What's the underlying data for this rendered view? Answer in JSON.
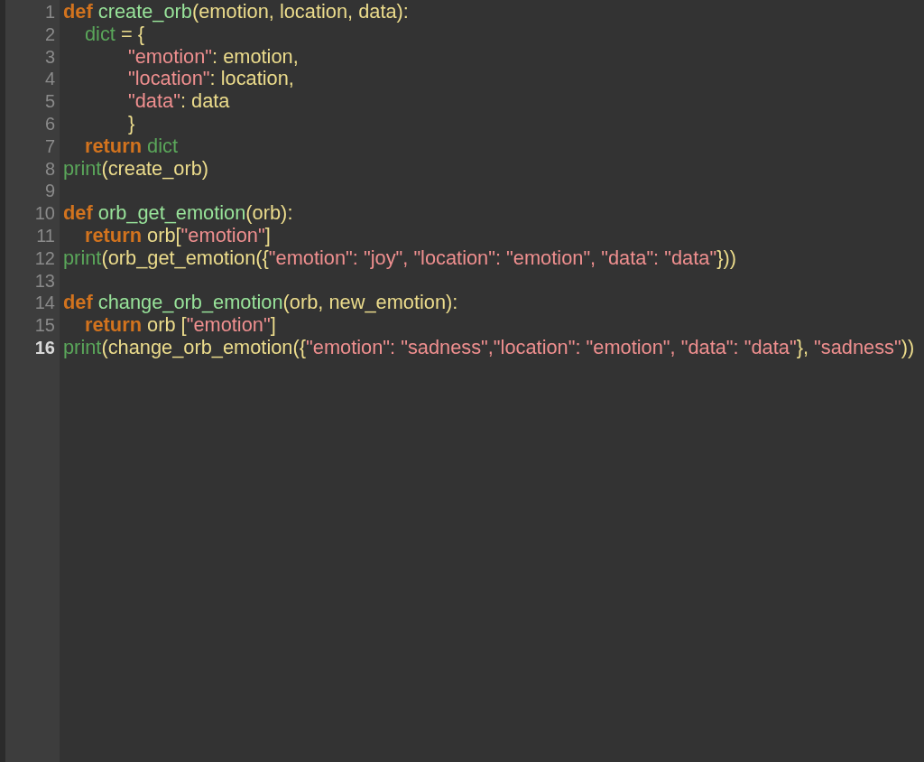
{
  "editor": {
    "lines": [
      {
        "number": "1",
        "current": false,
        "tokens": [
          {
            "kind": "keyword",
            "text": "def "
          },
          {
            "kind": "funcname",
            "text": "create_orb"
          },
          {
            "kind": "plain",
            "text": "(emotion, location, data):"
          }
        ]
      },
      {
        "number": "2",
        "current": false,
        "tokens": [
          {
            "kind": "builtin",
            "text": "\tdict"
          },
          {
            "kind": "plain",
            "text": " = {"
          }
        ]
      },
      {
        "number": "3",
        "current": false,
        "tokens": [
          {
            "kind": "string",
            "text": "\t\t\t\"emotion\""
          },
          {
            "kind": "plain",
            "text": ": emotion,"
          }
        ]
      },
      {
        "number": "4",
        "current": false,
        "tokens": [
          {
            "kind": "string",
            "text": "\t\t\t\"location\""
          },
          {
            "kind": "plain",
            "text": ": location,"
          }
        ]
      },
      {
        "number": "5",
        "current": false,
        "tokens": [
          {
            "kind": "string",
            "text": "\t\t\t\"data\""
          },
          {
            "kind": "plain",
            "text": ": data"
          }
        ]
      },
      {
        "number": "6",
        "current": false,
        "tokens": [
          {
            "kind": "plain",
            "text": "\t\t\t}"
          }
        ]
      },
      {
        "number": "7",
        "current": false,
        "tokens": [
          {
            "kind": "keyword",
            "text": "\treturn "
          },
          {
            "kind": "builtin",
            "text": "dict"
          }
        ]
      },
      {
        "number": "8",
        "current": false,
        "tokens": [
          {
            "kind": "builtin",
            "text": "print"
          },
          {
            "kind": "plain",
            "text": "(create_orb)"
          }
        ]
      },
      {
        "number": "9",
        "current": false
      },
      {
        "number": "10",
        "current": false,
        "tokens": [
          {
            "kind": "keyword",
            "text": "def "
          },
          {
            "kind": "funcname",
            "text": "orb_get_emotion"
          },
          {
            "kind": "plain",
            "text": "(orb):"
          }
        ]
      },
      {
        "number": "11",
        "current": false,
        "tokens": [
          {
            "kind": "keyword",
            "text": "\treturn"
          },
          {
            "kind": "plain",
            "text": " orb["
          },
          {
            "kind": "string",
            "text": "\"emotion\""
          },
          {
            "kind": "plain",
            "text": "]"
          }
        ]
      },
      {
        "number": "12",
        "current": false,
        "tokens": [
          {
            "kind": "builtin",
            "text": "print"
          },
          {
            "kind": "plain",
            "text": "(orb_get_emotion({"
          },
          {
            "kind": "string",
            "text": "\"emotion\": \"joy\", \"location\": \"emotion\", \"data\": \"data\""
          },
          {
            "kind": "plain",
            "text": "}))"
          }
        ]
      },
      {
        "number": "13",
        "current": false
      },
      {
        "number": "14",
        "current": false,
        "tokens": [
          {
            "kind": "keyword",
            "text": "def "
          },
          {
            "kind": "funcname",
            "text": "change_orb_emotion"
          },
          {
            "kind": "plain",
            "text": "(orb, new_emotion):"
          }
        ]
      },
      {
        "number": "15",
        "current": false,
        "tokens": [
          {
            "kind": "keyword",
            "text": "\treturn"
          },
          {
            "kind": "plain",
            "text": " orb ["
          },
          {
            "kind": "string",
            "text": "\"emotion\""
          },
          {
            "kind": "plain",
            "text": "]"
          }
        ]
      },
      {
        "number": "16",
        "current": true,
        "tokens": [
          {
            "kind": "builtin",
            "text": "print"
          },
          {
            "kind": "plain",
            "text": "(change_orb_emotion({"
          },
          {
            "kind": "string",
            "text": "\"emotion\": \"sadness\",\"location\": \"emotion\", \"data\": \"data\""
          },
          {
            "kind": "plain",
            "text": "}, "
          },
          {
            "kind": "string",
            "text": "\"sadness\""
          },
          {
            "kind": "plain",
            "text": "))"
          }
        ]
      }
    ]
  }
}
